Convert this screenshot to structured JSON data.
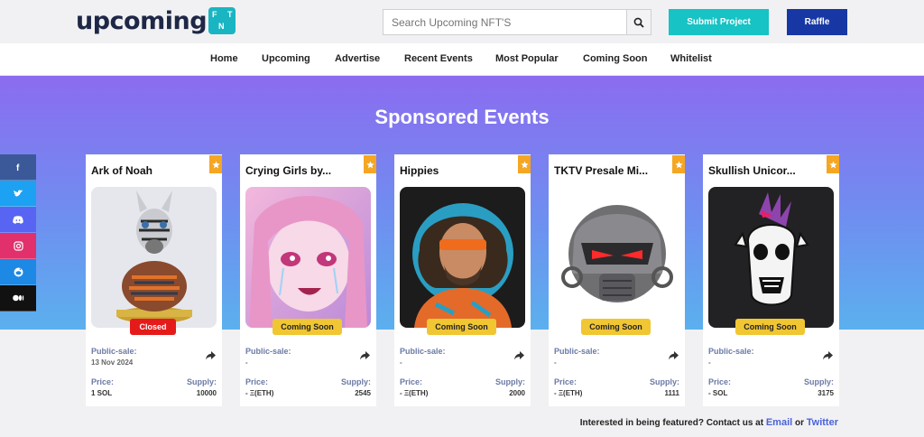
{
  "header": {
    "logo_text": "upcoming",
    "logo_letters": [
      "F",
      "N",
      "T"
    ],
    "search_placeholder": "Search Upcoming NFT'S",
    "submit_label": "Submit Project",
    "raffle_label": "Raffle"
  },
  "nav": [
    "Home",
    "Upcoming",
    "Advertise",
    "Recent Events",
    "Most Popular",
    "Coming Soon",
    "Whitelist"
  ],
  "hero": {
    "title": "Sponsored Events"
  },
  "social_icons": [
    "facebook-icon",
    "twitter-icon",
    "discord-icon",
    "instagram-icon",
    "reddit-icon",
    "medium-icon"
  ],
  "cards": [
    {
      "title": "Ark of Noah",
      "status": "Closed",
      "public_sale_label": "Public-sale:",
      "public_sale": "13 Nov 2024",
      "price_label": "Price:",
      "price": "1 SOL",
      "supply_label": "Supply:",
      "supply": "10000"
    },
    {
      "title": "Crying Girls by...",
      "status": "Coming Soon",
      "public_sale_label": "Public-sale:",
      "public_sale": "-",
      "price_label": "Price:",
      "price": "- Ξ(ETH)",
      "supply_label": "Supply:",
      "supply": "2545"
    },
    {
      "title": "Hippies",
      "status": "Coming Soon",
      "public_sale_label": "Public-sale:",
      "public_sale": "-",
      "price_label": "Price:",
      "price": "- Ξ(ETH)",
      "supply_label": "Supply:",
      "supply": "2000"
    },
    {
      "title": "TKTV Presale Mi...",
      "status": "Coming Soon",
      "public_sale_label": "Public-sale:",
      "public_sale": "-",
      "price_label": "Price:",
      "price": "- Ξ(ETH)",
      "supply_label": "Supply:",
      "supply": "1111"
    },
    {
      "title": "Skullish Unicor...",
      "status": "Coming Soon",
      "public_sale_label": "Public-sale:",
      "public_sale": "-",
      "price_label": "Price:",
      "price": "- SOL",
      "supply_label": "Supply:",
      "supply": "3175"
    }
  ],
  "footer": {
    "text": "Interested in being featured? Contact us at",
    "email_label": "Email",
    "or": "or",
    "twitter_label": "Twitter"
  },
  "colors": {
    "teal": "#17c3c4",
    "navy": "#1738a4",
    "star": "#f5a623",
    "closed": "#e51b1b",
    "soon": "#f1c633"
  }
}
